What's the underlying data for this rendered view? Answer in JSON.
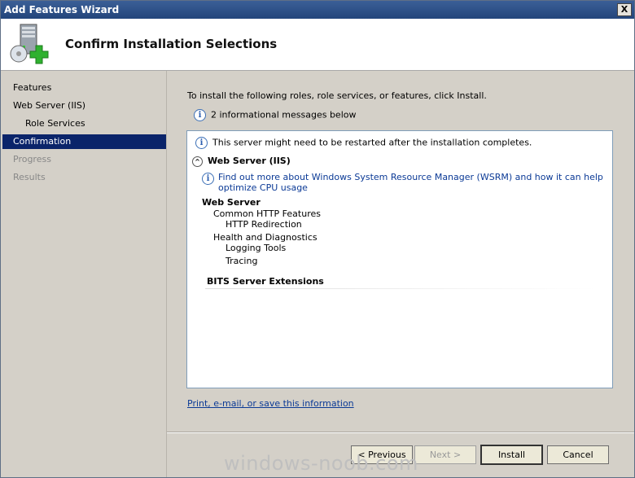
{
  "window": {
    "title": "Add Features Wizard",
    "close_label": "X"
  },
  "header": {
    "title": "Confirm Installation Selections",
    "icon": "server-add-icon"
  },
  "sidebar": {
    "items": [
      {
        "label": "Features",
        "state": "normal"
      },
      {
        "label": "Web Server (IIS)",
        "state": "normal"
      },
      {
        "label": "Role Services",
        "state": "normal"
      },
      {
        "label": "Confirmation",
        "state": "active"
      },
      {
        "label": "Progress",
        "state": "disabled"
      },
      {
        "label": "Results",
        "state": "disabled"
      }
    ]
  },
  "main": {
    "instruction": "To install the following roles, role services, or features, click Install.",
    "info_message": "2 informational messages below",
    "restart_warning": "This server might need to be restarted after the installation completes.",
    "section_title": "Web Server (IIS)",
    "wsrm_link": "Find out more about Windows System Resource Manager (WSRM) and how it can help optimize CPU usage",
    "tree": {
      "web_server": "Web Server",
      "common_http": "Common HTTP Features",
      "http_redirection": "HTTP Redirection",
      "health_diag": "Health and Diagnostics",
      "logging_tools": "Logging Tools",
      "tracing": "Tracing",
      "bits": "BITS Server Extensions"
    },
    "print_link": "Print, e-mail, or save this information"
  },
  "buttons": {
    "previous": "< Previous",
    "next": "Next >",
    "install": "Install",
    "cancel": "Cancel"
  },
  "watermark": "windows-noob.com"
}
